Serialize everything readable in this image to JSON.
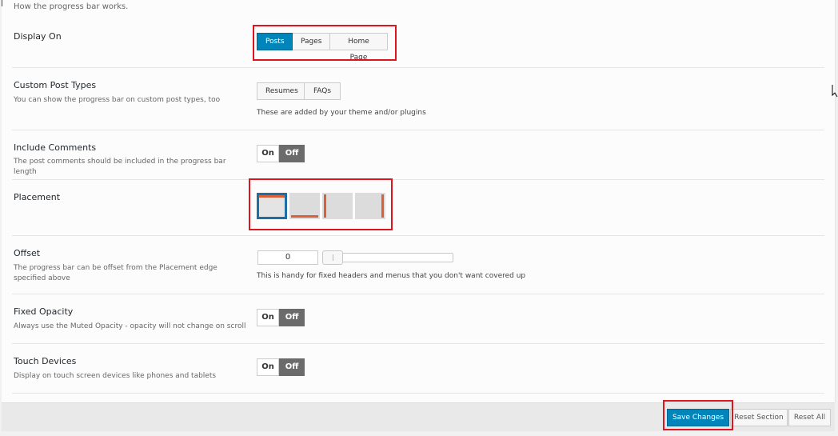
{
  "intro": "How the progress bar works.",
  "display_on": {
    "label": "Display On",
    "options": [
      "Posts",
      "Pages",
      "Home Page"
    ],
    "selected": "Posts"
  },
  "custom_post_types": {
    "label": "Custom Post Types",
    "description": "You can show the progress bar on custom post types, too",
    "options": [
      "Resumes",
      "FAQs"
    ],
    "hint": "These are added by your theme and/or plugins"
  },
  "include_comments": {
    "label": "Include Comments",
    "description": "The post comments should be included in the progress bar length",
    "on_label": "On",
    "off_label": "Off",
    "value": "Off"
  },
  "placement": {
    "label": "Placement",
    "options": [
      "top",
      "bottom",
      "left",
      "right"
    ],
    "selected": "top",
    "accent_color": "#d9613a",
    "selected_border_color": "#1c6ea4"
  },
  "offset": {
    "label": "Offset",
    "description": "The progress bar can be offset from the Placement edge specified above",
    "value": "0",
    "hint": "This is handy for fixed headers and menus that you don't want covered up"
  },
  "fixed_opacity": {
    "label": "Fixed Opacity",
    "description": "Always use the Muted Opacity - opacity will not change on scroll",
    "on_label": "On",
    "off_label": "Off",
    "value": "Off"
  },
  "touch_devices": {
    "label": "Touch Devices",
    "description": "Display on touch screen devices like phones and tablets",
    "on_label": "On",
    "off_label": "Off",
    "value": "Off"
  },
  "footer": {
    "save_label": "Save Changes",
    "reset_section_label": "Reset Section",
    "reset_all_label": "Reset All"
  },
  "colors": {
    "primary": "#0085ba",
    "highlight": "#e0141e"
  }
}
